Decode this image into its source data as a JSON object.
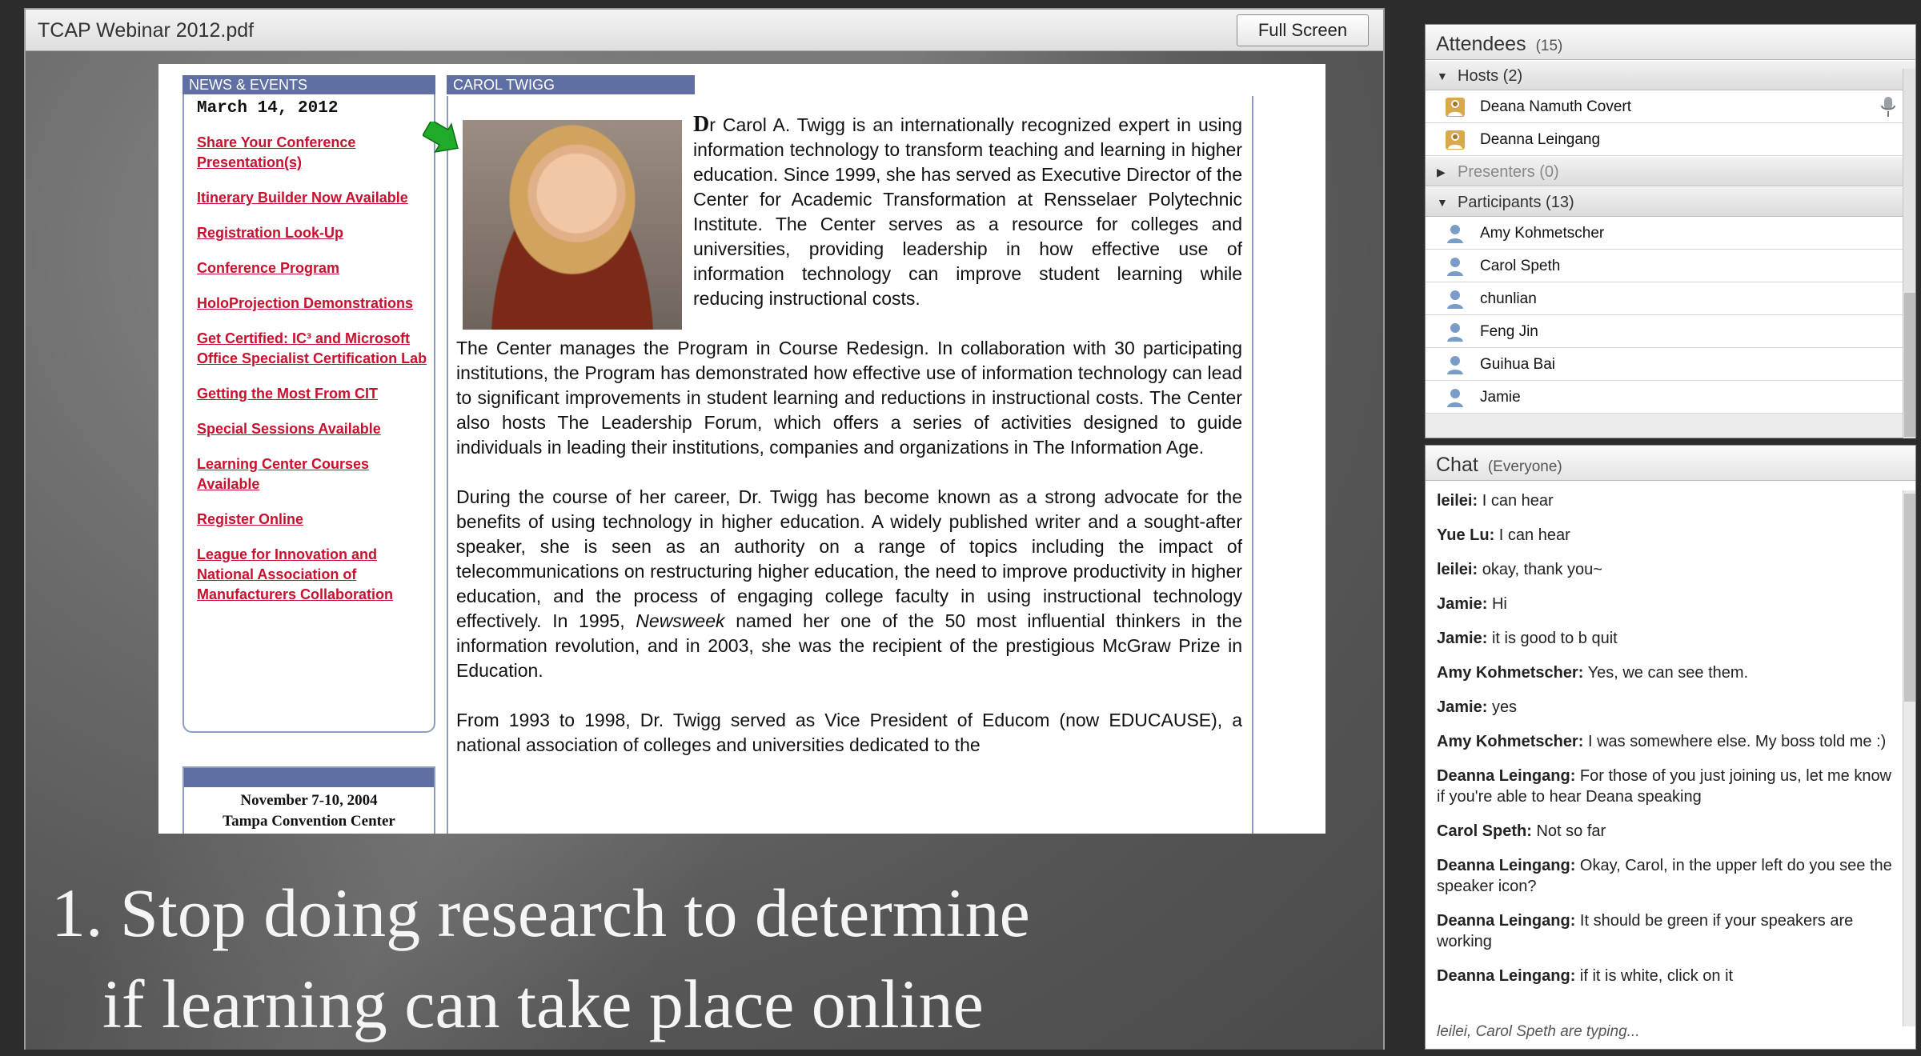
{
  "share": {
    "title": "TCAP Webinar 2012.pdf",
    "fullscreen_label": "Full Screen"
  },
  "webpage": {
    "news_header": "NEWS & EVENTS",
    "news_date": "March 14, 2012",
    "news_links": [
      "Share Your Conference Presentation(s)",
      "Itinerary Builder Now Available",
      "Registration Look-Up",
      "Conference Program",
      "HoloProjection Demonstrations",
      "Get Certified: IC³ and Microsoft Office Specialist Certification Lab",
      "Getting the Most From CIT",
      "Special Sessions Available",
      "Learning Center Courses Available",
      "Register Online",
      "League for Innovation and National Association of Manufacturers Collaboration"
    ],
    "event_line1": "November 7-10, 2004",
    "event_line2": "Tampa Convention Center",
    "bio_header": "CAROL TWIGG",
    "bio_initial": "D",
    "bio_p1": "r Carol A. Twigg is an internationally recognized expert in using information technology to transform teaching and learning in higher education. Since 1999, she has served as Executive Director of the Center for Academic Transformation at Rensselaer Polytechnic Institute. The Center serves as a resource for colleges and universities, providing leadership in how effective use of information technology can improve student learning while reducing instructional costs.",
    "bio_p2": "The Center manages the Program in Course Redesign.  In collaboration with 30 participating institutions, the Program has demonstrated how effective use of information technology can lead to significant improvements in student learning and reductions in instructional costs.  The Center also hosts The Leadership Forum, which offers a series of activities designed to guide individuals in leading their institutions, companies and organizations in The Information Age.",
    "bio_p3a": "During the course of her career, Dr. Twigg has become known as a strong advocate for the benefits of using technology in higher education.  A widely published writer and a sought-after speaker, she is seen as an authority on a range of topics including the impact of telecommunications on restructuring higher education, the need to improve productivity in higher education, and the process of engaging college faculty in using instructional technology effectively. In 1995,",
    "bio_p3_em": "Newsweek",
    "bio_p3b": "named her one of the 50 most influential thinkers in the information revolution, and in 2003, she was the recipient of the prestigious McGraw Prize in Education.",
    "bio_p4": "From 1993 to 1998, Dr. Twigg served as Vice President of Educom (now EDUCAUSE), a national association of colleges and universities dedicated to the"
  },
  "slide_caption": {
    "line1": "1. Stop doing research to determine",
    "line2": "if learning can take place online"
  },
  "attendees": {
    "title": "Attendees",
    "count": "(15)",
    "hosts_label": "Hosts (2)",
    "hosts": [
      "Deana Namuth Covert",
      "Deanna Leingang"
    ],
    "presenters_label": "Presenters (0)",
    "participants_label": "Participants (13)",
    "participants": [
      "Amy Kohmetscher",
      "Carol Speth",
      "chunlian",
      "Feng Jin",
      "Guihua Bai",
      "Jamie"
    ]
  },
  "chat": {
    "title": "Chat",
    "scope": "(Everyone)",
    "messages": [
      {
        "from": "leilei:",
        "text": "I can hear"
      },
      {
        "from": "Yue Lu:",
        "text": "I can hear"
      },
      {
        "from": "leilei:",
        "text": "okay, thank you~"
      },
      {
        "from": "Jamie:",
        "text": "Hi"
      },
      {
        "from": "Jamie:",
        "text": "it is good to b quit"
      },
      {
        "from": "Amy Kohmetscher:",
        "text": "Yes, we can see them."
      },
      {
        "from": "Jamie:",
        "text": "yes"
      },
      {
        "from": "Amy Kohmetscher:",
        "text": "I was somewhere else. My boss told me :)"
      },
      {
        "from": "Deanna Leingang:",
        "text": "For those of you just joining us, let me know if you're able to hear Deana speaking"
      },
      {
        "from": "Carol Speth:",
        "text": "Not so far"
      },
      {
        "from": "Deanna Leingang:",
        "text": "Okay, Carol, in the upper left do you see the speaker icon?"
      },
      {
        "from": "Deanna Leingang:",
        "text": "It should be green if your speakers are working"
      },
      {
        "from": "Deanna Leingang:",
        "text": "if it is white, click on it"
      }
    ],
    "typing": "leilei, Carol Speth are typing..."
  },
  "colors": {
    "link_red": "#c8102e",
    "header_blue": "#5f6fa4",
    "arrow_green": "#1faa2a"
  }
}
